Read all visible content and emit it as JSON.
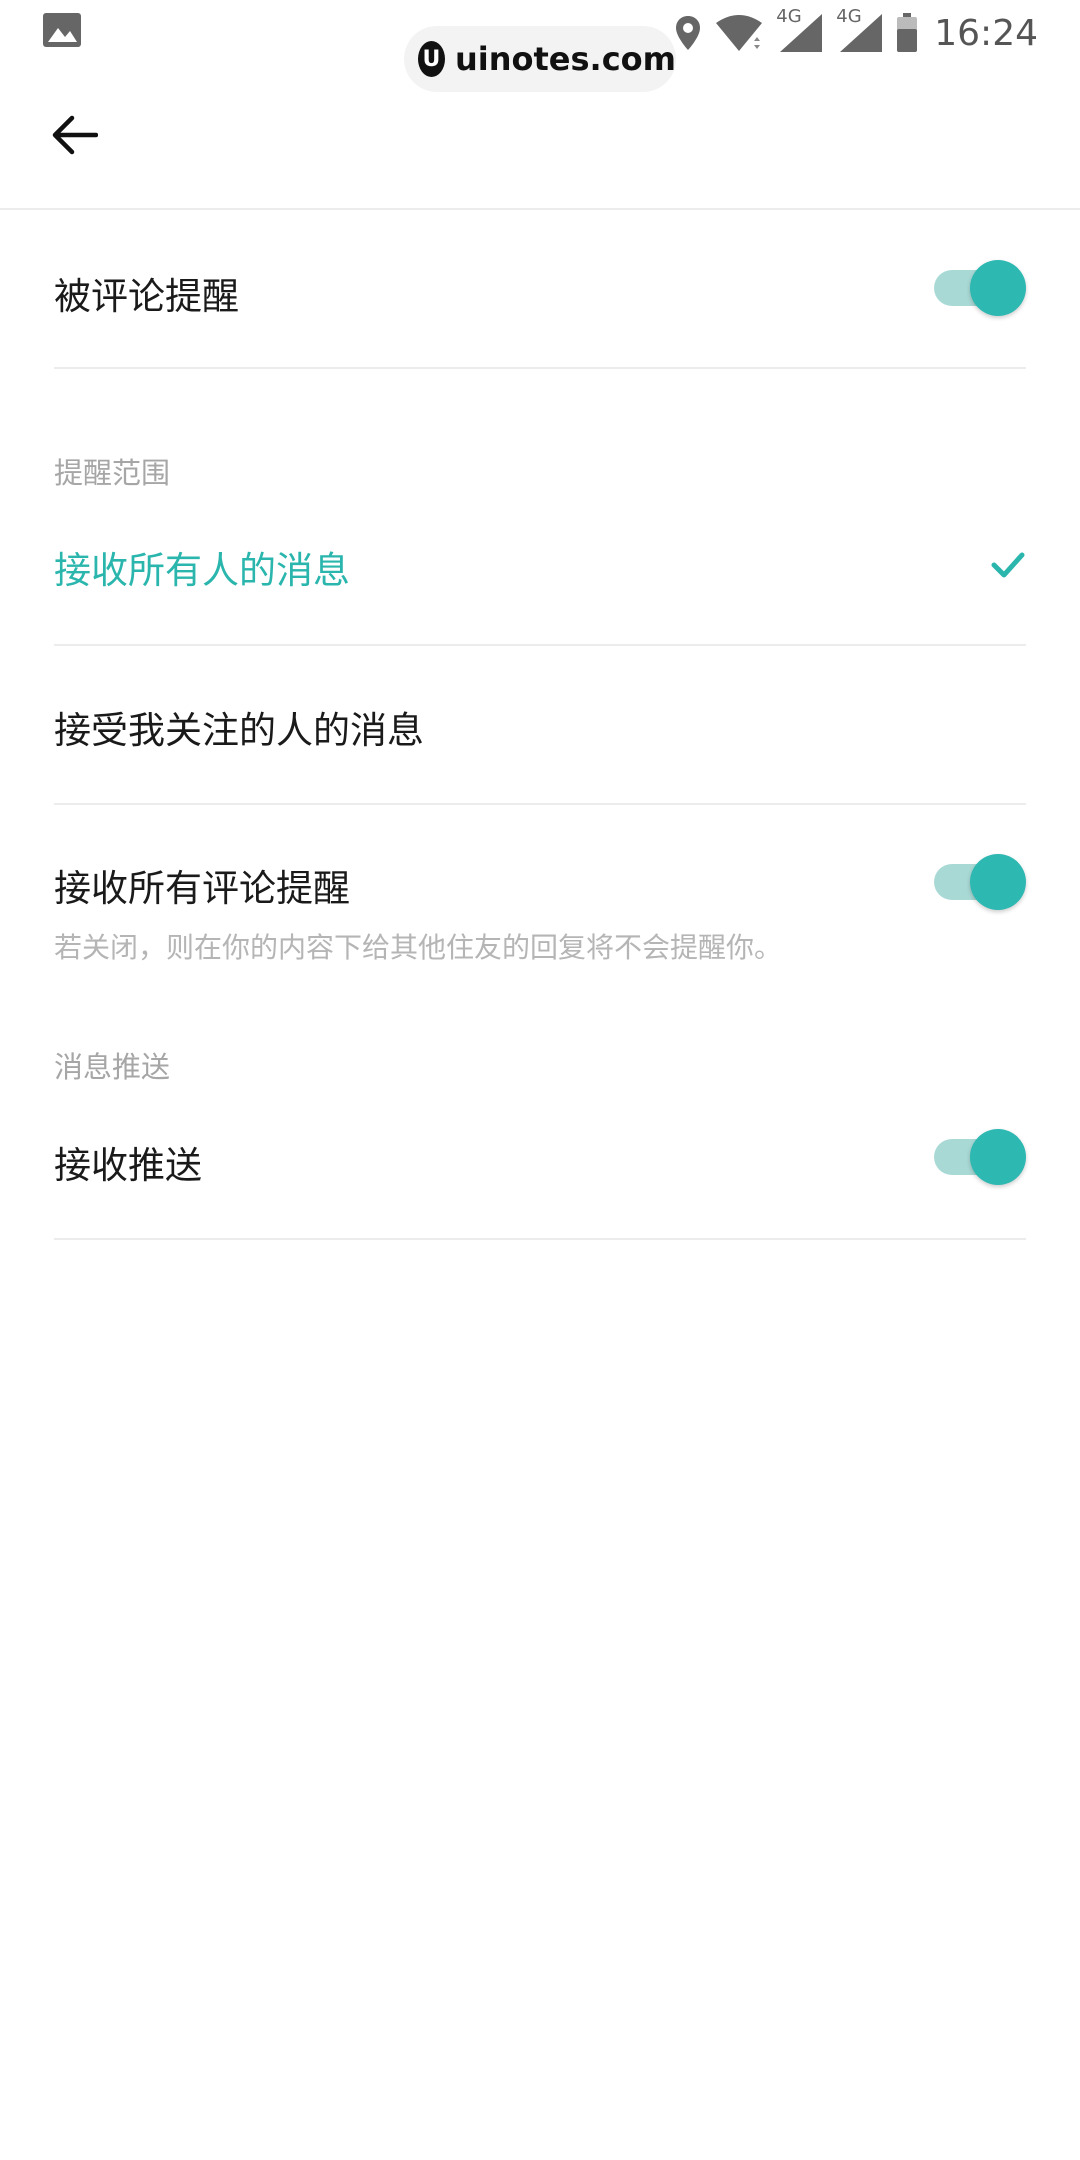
{
  "status_bar": {
    "watermark_logo": "U",
    "watermark_text": "uinotes.com",
    "net1": "4G",
    "net2": "4G",
    "time": "16:24"
  },
  "settings": {
    "comment_reminder": {
      "label": "被评论提醒",
      "enabled": true
    },
    "scope_section": "提醒范围",
    "scope_all": {
      "label": "接收所有人的消息",
      "selected": true
    },
    "scope_following": {
      "label": "接受我关注的人的消息",
      "selected": false
    },
    "all_comments": {
      "label": "接收所有评论提醒",
      "description": "若关闭，则在你的内容下给其他住友的回复将不会提醒你。",
      "enabled": true
    },
    "push_section": "消息推送",
    "push": {
      "label": "接收推送",
      "enabled": true
    }
  },
  "colors": {
    "accent": "#2ab5ad",
    "toggle_track": "#a9d9d5",
    "toggle_thumb": "#2db8b2"
  },
  "icons": [
    "image-icon",
    "location-icon",
    "wifi-icon",
    "signal-icon",
    "battery-icon",
    "back-arrow-icon",
    "check-icon"
  ]
}
